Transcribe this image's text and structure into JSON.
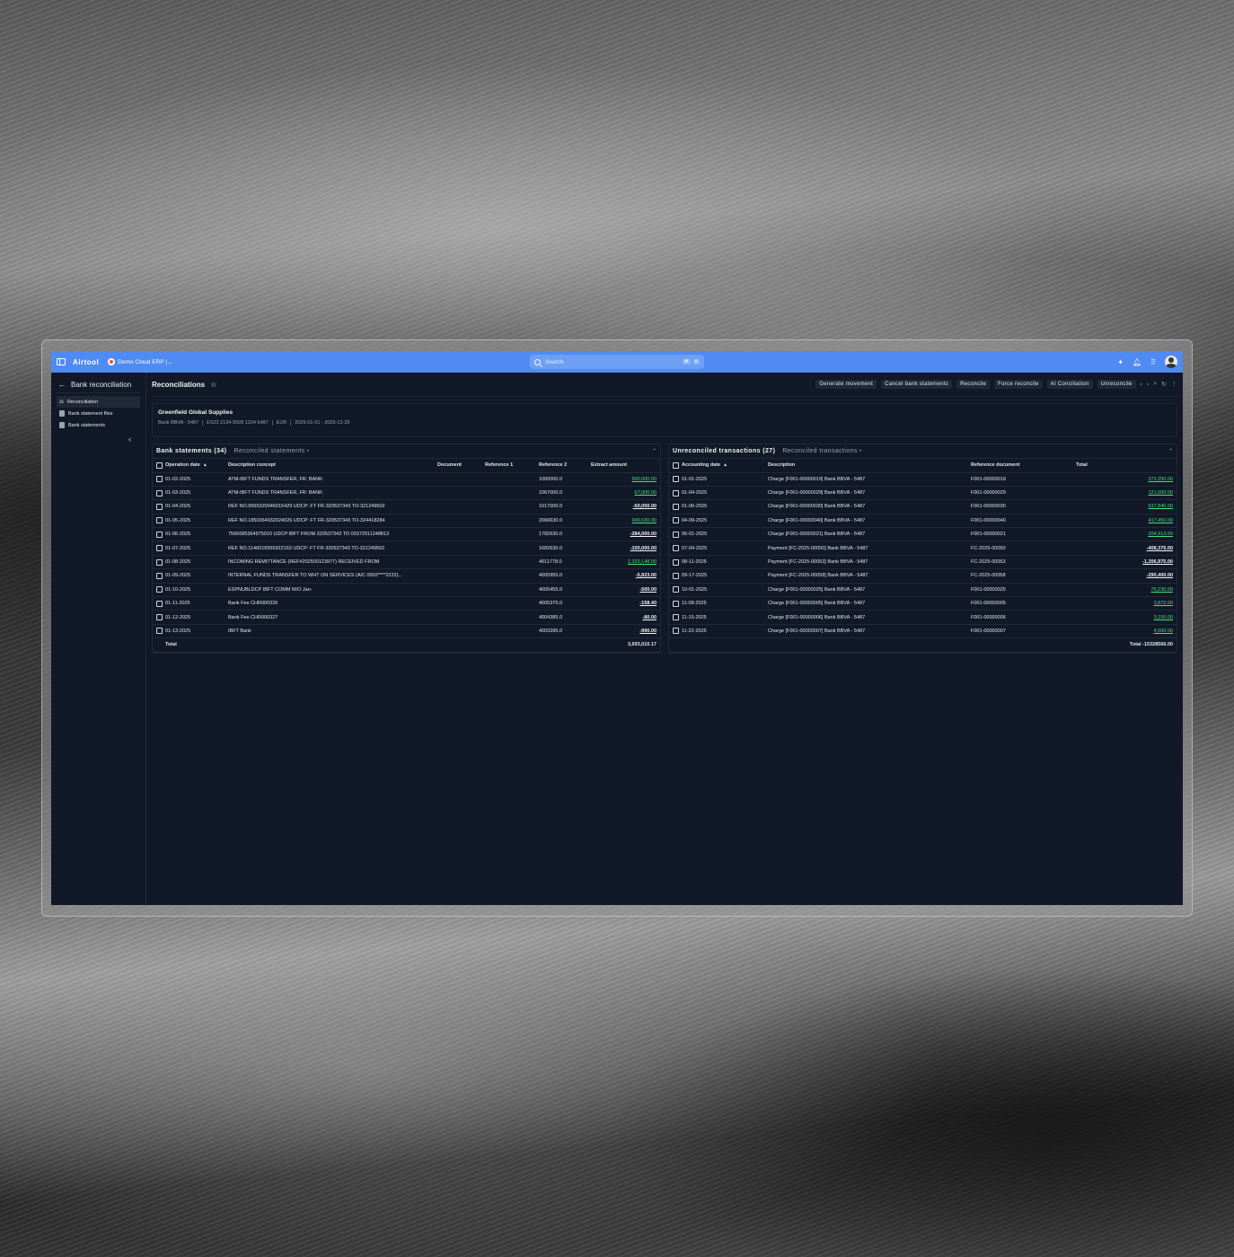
{
  "topbar": {
    "brand": "Airtool",
    "org": "Demo Cloud ERP (...",
    "search_placeholder": "Search",
    "kbd": [
      "⌘",
      "K"
    ]
  },
  "sidebar": {
    "back_label": "Bank reconciliation",
    "items": [
      {
        "label": "Reconciliation",
        "icon": "scale-icon",
        "active": true
      },
      {
        "label": "Bank statement files",
        "icon": "file-icon",
        "active": false
      },
      {
        "label": "Bank statements",
        "icon": "document-icon",
        "active": false
      }
    ]
  },
  "page": {
    "title": "Reconciliations",
    "actions": [
      "Generate movement",
      "Cancel bank statements",
      "Reconcile",
      "Force reconcile",
      "AI Conciliation",
      "Unreconcile"
    ]
  },
  "info": {
    "company": "Greenfield Global Supplies",
    "bank": "Bank BBVA - 5487",
    "iban": "ES23 2134 9928 1234 5487",
    "currency": "EUR",
    "period": "2025-01-01 - 2025-12-29"
  },
  "bank_statements": {
    "title": "Bank statements (34)",
    "tab": "Reconciled statements",
    "columns": [
      "Operation date",
      "Description concept",
      "Document",
      "Reference 1",
      "Reference 2",
      "Extract amount"
    ],
    "rows": [
      {
        "date": "01-02-2025",
        "desc": "ATM-IBFT FUNDS TRANSFER, FR: BANK:",
        "doc": "",
        "ref1": "",
        "ref2": "1000000.0",
        "amount": "500,000.00",
        "sign": "pos"
      },
      {
        "date": "01-03-2025",
        "desc": "ATM-IBFT FUNDS TRANSFER, FR: BANK:",
        "doc": "",
        "ref1": "",
        "ref2": "1067000.0",
        "amount": "67,000.00",
        "sign": "pos"
      },
      {
        "date": "01-04-2025",
        "desc": "REF NO.9655320046015429 UDCP: FT FR-320537343 TO-321249502",
        "doc": "",
        "ref1": "",
        "ref2": "1017000.0",
        "amount": "-50,000.00",
        "sign": "neg"
      },
      {
        "date": "01-05-2025",
        "desc": "REF NO.1850364932024026 UDCP: FT FR-320537343 TO-324418284",
        "doc": "",
        "ref1": "",
        "ref2": "2066630.0",
        "amount": "949,630.00",
        "sign": "pos"
      },
      {
        "date": "01-06-2025",
        "desc": "7566685364975010 UDCP:IBFT FROM 320537343 TO 00372011248813",
        "doc": "",
        "ref1": "",
        "ref2": "1782630.0",
        "amount": "-284,000.00",
        "sign": "neg"
      },
      {
        "date": "01-07-2025",
        "desc": "REF NO.1146016955922163 UDCP: FT FR-320537343 TO-321249502",
        "doc": "",
        "ref1": "",
        "ref2": "1682630.0",
        "amount": "-100,000.00",
        "sign": "neg"
      },
      {
        "date": "01-08-2025",
        "desc": "INCOMING REMITTANCE (REF#202500123977) RECEIVED FROM",
        "doc": "",
        "ref1": "",
        "ref2": "4011778.0",
        "amount": "2,329,148.00",
        "sign": "pos"
      },
      {
        "date": "01-09-2025",
        "desc": "INTERNAL FUNDS TRANSFER TO WHT ON SERVICES (A/C 0002****2222)...",
        "doc": "",
        "ref1": "",
        "ref2": "4005955.0",
        "amount": "-5,823.00",
        "sign": "neg"
      },
      {
        "date": "01-10-2025",
        "desc": "ESPNUBLDCP IBFT COMM M/O Jan-",
        "doc": "",
        "ref1": "",
        "ref2": "4005455.0",
        "amount": "-500.00",
        "sign": "neg"
      },
      {
        "date": "01-11-2025",
        "desc": "Bank Fee CHR000326",
        "doc": "",
        "ref1": "",
        "ref2": "4005375.0",
        "amount": "-158.40",
        "sign": "neg"
      },
      {
        "date": "01-12-2025",
        "desc": "Bank Fee CHR000327",
        "doc": "",
        "ref1": "",
        "ref2": "4004385.0",
        "amount": "-80.00",
        "sign": "neg"
      },
      {
        "date": "01-13-2025",
        "desc": "IBFT Bank",
        "doc": "",
        "ref1": "",
        "ref2": "4003395.0",
        "amount": "-990.00",
        "sign": "neg"
      }
    ],
    "total_label": "Total",
    "total_value": "3,693,010.17"
  },
  "unreconciled": {
    "title": "Unreconciled transactions (27)",
    "tab": "Reconciled transactions",
    "columns": [
      "Accounting date",
      "Description",
      "Reference document",
      "Total"
    ],
    "rows": [
      {
        "date": "01-01-2025",
        "desc": "Charge [F001-00000019] Bank BBVA - 5487",
        "ref": "F001-00000019",
        "total": "272,250.00",
        "sign": "pos"
      },
      {
        "date": "01-04-2025",
        "desc": "Charge [F001-00000029] Bank BBVA - 5487",
        "ref": "F001-00000029",
        "total": "121,000.00",
        "sign": "pos"
      },
      {
        "date": "01-06-2025",
        "desc": "Charge [F001-00000030] Bank BBVA - 5487",
        "ref": "F001-00000030",
        "total": "537,845.00",
        "sign": "pos"
      },
      {
        "date": "04-09-2025",
        "desc": "Charge [F001-00000040] Bank BBVA - 5487",
        "ref": "F001-00000040",
        "total": "417,450.00",
        "sign": "pos"
      },
      {
        "date": "06-01-2025",
        "desc": "Charge [F001-00000021] Bank BBVA - 5487",
        "ref": "F001-00000021",
        "total": "204,913.50",
        "sign": "pos"
      },
      {
        "date": "07-04-2025",
        "desc": "Payment [FC-2025-00050] Bank BBVA - 5487",
        "ref": "FC-2025-00050",
        "total": "-408,375.00",
        "sign": "neg"
      },
      {
        "date": "08-11-2025",
        "desc": "Payment [FC-2025-00053] Bank BBVA - 5487",
        "ref": "FC-2025-00053",
        "total": "-1,206,975.00",
        "sign": "neg"
      },
      {
        "date": "09-17-2025",
        "desc": "Payment [FC-2025-00058] Bank BBVA - 5487",
        "ref": "FC-2025-00058",
        "total": "-290,400.00",
        "sign": "neg"
      },
      {
        "date": "10-01-2025",
        "desc": "Charge [F001-00000025] Bank BBVA - 5487",
        "ref": "F001-00000025",
        "total": "76,230.00",
        "sign": "pos"
      },
      {
        "date": "11-08-2025",
        "desc": "Charge [F001-00000005] Bank BBVA - 5487",
        "ref": "F001-00000005",
        "total": "3,872.00",
        "sign": "pos"
      },
      {
        "date": "11-15-2025",
        "desc": "Charge [F001-00000006] Bank BBVA - 5487",
        "ref": "F001-00000006",
        "total": "3,150.00",
        "sign": "pos"
      },
      {
        "date": "11-22-2025",
        "desc": "Charge [F001-00000007] Bank BBVA - 5487",
        "ref": "F001-00000007",
        "total": "4,500.00",
        "sign": "pos"
      }
    ],
    "total_label": "Total -15328566.00"
  }
}
